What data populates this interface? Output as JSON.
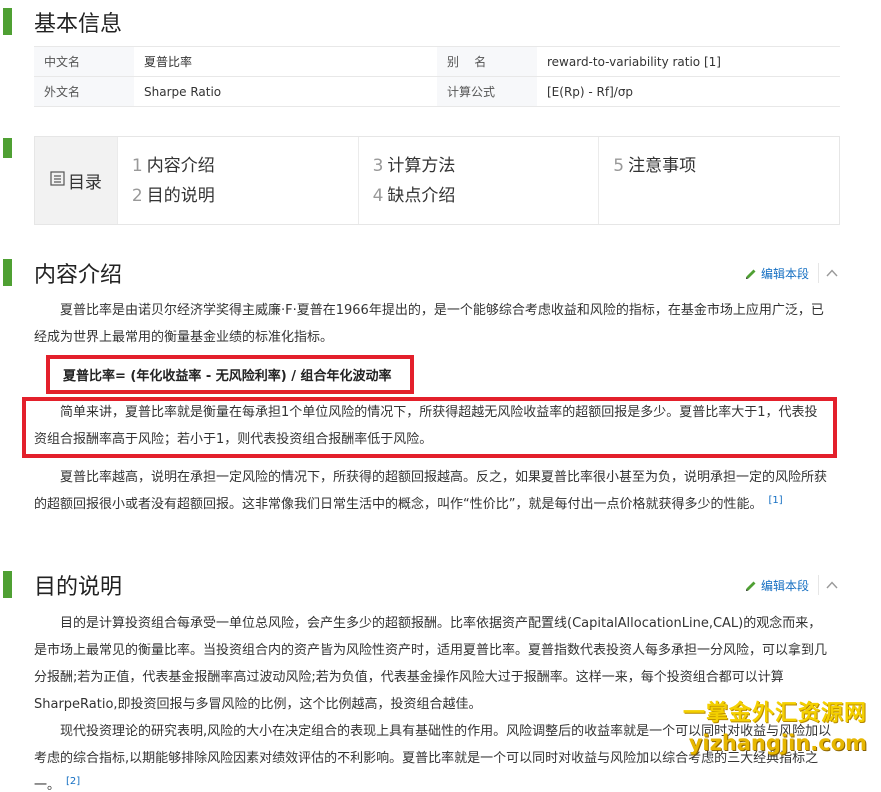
{
  "basic_info": {
    "title": "基本信息",
    "rows": [
      {
        "k1": "中文名",
        "v1": "夏普比率",
        "k2": "别    名",
        "v2": "reward-to-variability ratio [1]"
      },
      {
        "k1": "外文名",
        "v1": "Sharpe Ratio",
        "k2": "计算公式",
        "v2": "[E(Rp) - Rf]/σp"
      }
    ]
  },
  "catalog": {
    "label": "目录",
    "items": [
      {
        "num": "1",
        "text": "内容介绍"
      },
      {
        "num": "2",
        "text": "目的说明"
      },
      {
        "num": "3",
        "text": "计算方法"
      },
      {
        "num": "4",
        "text": "缺点介绍"
      },
      {
        "num": "5",
        "text": "注意事项"
      }
    ]
  },
  "sections": {
    "intro": {
      "title": "内容介绍",
      "edit_label": "编辑本段",
      "p1": "夏普比率是由诺贝尔经济学奖得主威廉·F·夏普在1966年提出的，是一个能够综合考虑收益和风险的指标，在基金市场上应用广泛，已经成为世界上最常用的衡量基金业绩的标准化指标。",
      "formula": "夏普比率= (年化收益率 - 无风险利率) / 组合年化波动率",
      "p2": "简单来讲，夏普比率就是衡量在每承担1个单位风险的情况下，所获得超越无风险收益率的超额回报是多少。夏普比率大于1，代表投资组合报酬率高于风险；若小于1，则代表投资组合报酬率低于风险。",
      "p3": "夏普比率越高，说明在承担一定风险的情况下，所获得的超额回报越高。反之，如果夏普比率很小甚至为负，说明承担一定的风险所获的超额回报很小或者没有超额回报。这非常像我们日常生活中的概念，叫作“性价比”，就是每付出一点价格就获得多少的性能。",
      "p3_ref": "[1]"
    },
    "purpose": {
      "title": "目的说明",
      "edit_label": "编辑本段",
      "p1": "目的是计算投资组合每承受一单位总风险，会产生多少的超额报酬。比率依据资产配置线(CapitalAllocationLine,CAL)的观念而来，是市场上最常见的衡量比率。当投资组合内的资产皆为风险性资产时，适用夏普比率。夏普指数代表投资人每多承担一分风险，可以拿到几分报酬;若为正值，代表基金报酬率高过波动风险;若为负值，代表基金操作风险大过于报酬率。这样一来，每个投资组合都可以计算SharpeRatio,即投资回报与多冒风险的比例，这个比例越高，投资组合越佳。",
      "p2": "现代投资理论的研究表明,风险的大小在决定组合的表现上具有基础性的作用。风险调整后的收益率就是一个可以同时对收益与风险加以考虑的综合指标,以期能够排除风险因素对绩效评估的不利影响。夏普比率就是一个可以同时对收益与风险加以综合考虑的三大经典指标之一。",
      "p2_ref": "[2]"
    }
  },
  "watermark": {
    "line1": "一掌金外汇资源网",
    "line2": "yizhangjin.com"
  },
  "colors": {
    "accent_green": "#4fa033",
    "link_blue": "#136ec2",
    "highlight_red": "#e3202b"
  }
}
